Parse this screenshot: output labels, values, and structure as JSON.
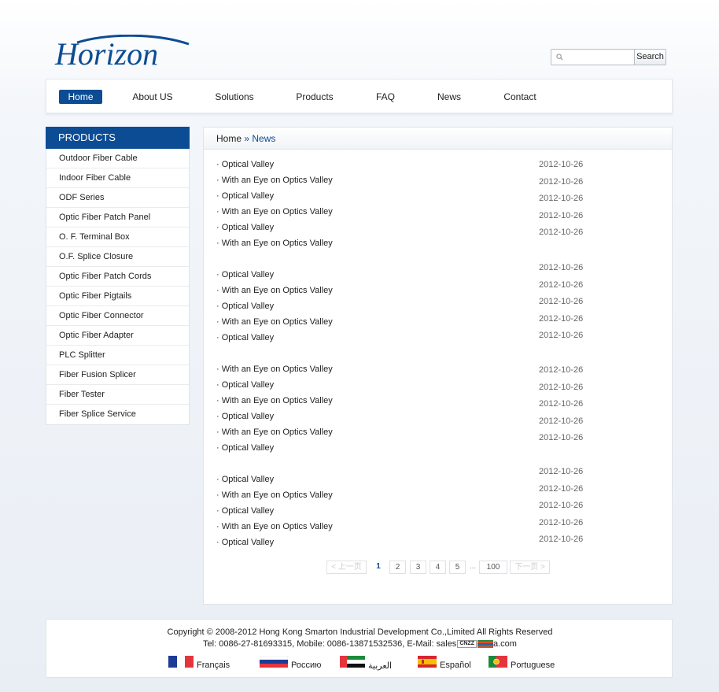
{
  "header": {
    "logo_text": "Horizon",
    "search": {
      "placeholder": "",
      "button_label": "Search"
    }
  },
  "nav": [
    {
      "label": "Home",
      "active": true
    },
    {
      "label": "About US"
    },
    {
      "label": "Solutions"
    },
    {
      "label": "Products"
    },
    {
      "label": "FAQ"
    },
    {
      "label": "News"
    },
    {
      "label": "Contact"
    }
  ],
  "sidebar": {
    "title": "PRODUCTS",
    "items": [
      "Outdoor Fiber Cable",
      "Indoor Fiber Cable",
      "ODF Series",
      "Optic Fiber Patch Panel",
      "O. F. Terminal Box",
      "O.F. Splice Closure",
      "Optic Fiber Patch Cords",
      "Optic Fiber Pigtails",
      "Optic Fiber Connector",
      "Optic Fiber Adapter",
      "PLC Splitter",
      "Fiber Fusion Splicer",
      "Fiber Tester",
      "Fiber Splice Service"
    ]
  },
  "breadcrumb": {
    "home": "Home",
    "sep": "»",
    "current": "News"
  },
  "news": {
    "groups": [
      {
        "titles": [
          "· Optical Valley",
          "· With an Eye on Optics Valley",
          "· Optical Valley",
          "· With an Eye on Optics Valley",
          "· Optical Valley",
          "· With an Eye on Optics Valley"
        ],
        "dates": [
          "2012-10-26",
          "2012-10-26",
          "2012-10-26",
          "2012-10-26",
          "2012-10-26"
        ]
      },
      {
        "titles": [
          "· Optical Valley",
          "· With an Eye on Optics Valley",
          "· Optical Valley",
          "· With an Eye on Optics Valley",
          "· Optical Valley"
        ],
        "dates": [
          "2012-10-26",
          "2012-10-26",
          "2012-10-26",
          "2012-10-26",
          "2012-10-26"
        ]
      },
      {
        "titles": [
          "· With an Eye on Optics Valley",
          "· Optical Valley",
          "· With an Eye on Optics Valley",
          "· Optical Valley",
          "· With an Eye on Optics Valley",
          "· Optical Valley"
        ],
        "dates": [
          "2012-10-26",
          "2012-10-26",
          "2012-10-26",
          "2012-10-26",
          "2012-10-26"
        ]
      },
      {
        "titles": [
          "· Optical Valley",
          "· With an Eye on Optics Valley",
          "· Optical Valley",
          "· With an Eye on Optics Valley",
          "· Optical Valley"
        ],
        "dates": [
          "2012-10-26",
          "2012-10-26",
          "2012-10-26",
          "2012-10-26",
          "2012-10-26"
        ]
      }
    ]
  },
  "pager": {
    "prev": "< 上一页",
    "pages": [
      "1",
      "2",
      "3",
      "4",
      "5"
    ],
    "current": "1",
    "ellipsis": "...",
    "last": "100",
    "next": "下一页 >"
  },
  "footer": {
    "copyright": "Copyright © 2008-2012 Hong Kong Smarton Industrial Development Co.,Limited   All Rights Reserved",
    "contact_prefix": "Tel: 0086-27-81693315, Mobile: 0086-13871532536, E-Mail: sales",
    "contact_badge": "CNZZ",
    "contact_suffix": "a.com",
    "languages": [
      {
        "label": "Français",
        "icon": "flag-france-icon"
      },
      {
        "label": "Россию",
        "icon": "flag-russia-icon"
      },
      {
        "label": "العربية",
        "icon": "flag-uae-icon"
      },
      {
        "label": "Español",
        "icon": "flag-spain-icon"
      },
      {
        "label": "Portuguese",
        "icon": "flag-portugal-icon"
      }
    ]
  },
  "colors": {
    "brand_blue": "#0c4c94",
    "link_blue": "#0c4c94"
  }
}
